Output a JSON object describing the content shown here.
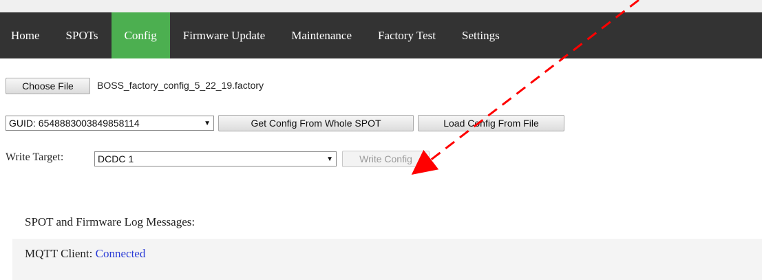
{
  "nav": {
    "items": [
      {
        "label": "Home"
      },
      {
        "label": "SPOTs"
      },
      {
        "label": "Config",
        "active": true
      },
      {
        "label": "Firmware Update"
      },
      {
        "label": "Maintenance"
      },
      {
        "label": "Factory Test"
      },
      {
        "label": "Settings"
      }
    ],
    "bg_color": "#333333",
    "active_color": "#4caf50"
  },
  "file": {
    "button_label": "Choose File",
    "filename": "BOSS_factory_config_5_22_19.factory"
  },
  "guid": {
    "selected": "GUID: 6548883003849858114",
    "get_config_label": "Get Config From Whole SPOT",
    "load_config_label": "Load Config From File"
  },
  "write": {
    "label": "Write Target:",
    "selected": "DCDC 1",
    "button_label": "Write Config"
  },
  "log": {
    "title": "SPOT and Firmware Log Messages:",
    "mqtt_label": "MQTT Client:",
    "mqtt_status": "Connected",
    "status_color": "#2a3bd6"
  },
  "annotation": {
    "arrow_color": "#ff0000",
    "arrow_icon": "dashed-arrow-icon"
  }
}
